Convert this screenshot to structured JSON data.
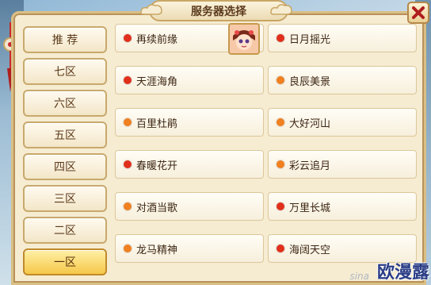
{
  "window": {
    "title": "服务器选择",
    "close_icon": "close-x-icon"
  },
  "colors": {
    "status_red": "#e0301c",
    "status_orange": "#f08020",
    "selected_tab": "#f5c84a"
  },
  "zones": [
    {
      "label": "推  荐",
      "selected": false
    },
    {
      "label": "七区",
      "selected": false
    },
    {
      "label": "六区",
      "selected": false
    },
    {
      "label": "五区",
      "selected": false
    },
    {
      "label": "四区",
      "selected": false
    },
    {
      "label": "三区",
      "selected": false
    },
    {
      "label": "二区",
      "selected": false
    },
    {
      "label": "一区",
      "selected": true
    }
  ],
  "servers": [
    {
      "name": "再续前缘",
      "status": "red",
      "avatar": "character-portrait"
    },
    {
      "name": "日月摇光",
      "status": "red"
    },
    {
      "name": "天涯海角",
      "status": "red"
    },
    {
      "name": "良辰美景",
      "status": "orange"
    },
    {
      "name": "百里杜鹃",
      "status": "orange"
    },
    {
      "name": "大好河山",
      "status": "orange"
    },
    {
      "name": "春暖花开",
      "status": "red"
    },
    {
      "name": "彩云追月",
      "status": "orange"
    },
    {
      "name": "对酒当歌",
      "status": "orange"
    },
    {
      "name": "万里长城",
      "status": "red"
    },
    {
      "name": "龙马精神",
      "status": "orange"
    },
    {
      "name": "海阔天空",
      "status": "red"
    }
  ],
  "watermark": {
    "site": "sina",
    "brand": "欧漫露"
  }
}
